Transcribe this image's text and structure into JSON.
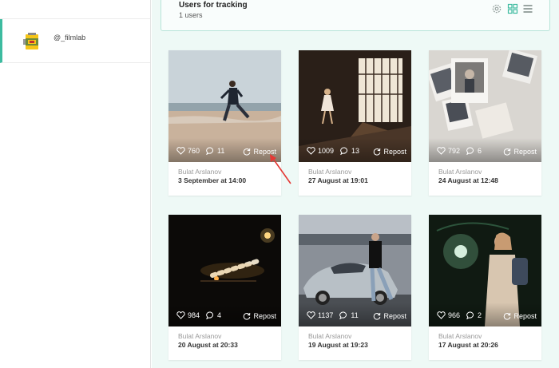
{
  "sidebar": {
    "account": {
      "handle": "@_filmlab"
    }
  },
  "tracking": {
    "title": "Users for tracking",
    "count": "1 users"
  },
  "posts": [
    {
      "likes": "760",
      "comments": "11",
      "repost_label": "Repost",
      "author": "Bulat Arslanov",
      "date": "3 September at 14:00"
    },
    {
      "likes": "1009",
      "comments": "13",
      "repost_label": "Repost",
      "author": "Bulat Arslanov",
      "date": "27 August at 19:01"
    },
    {
      "likes": "792",
      "comments": "6",
      "repost_label": "Repost",
      "author": "Bulat Arslanov",
      "date": "24 August at 12:48"
    },
    {
      "likes": "984",
      "comments": "4",
      "repost_label": "Repost",
      "author": "Bulat Arslanov",
      "date": "20 August at 20:33"
    },
    {
      "likes": "1137",
      "comments": "11",
      "repost_label": "Repost",
      "author": "Bulat Arslanov",
      "date": "19 August at 19:23"
    },
    {
      "likes": "966",
      "comments": "2",
      "repost_label": "Repost",
      "author": "Bulat Arslanov",
      "date": "17 August at 20:26"
    }
  ],
  "colors": {
    "accent": "#3dbba0",
    "background": "#eef9f6",
    "annotation_arrow": "#e53935"
  },
  "icons": [
    "settings-icon",
    "grid-view-icon",
    "list-view-icon",
    "heart-icon",
    "comment-icon",
    "repost-icon",
    "film-canister-icon"
  ]
}
